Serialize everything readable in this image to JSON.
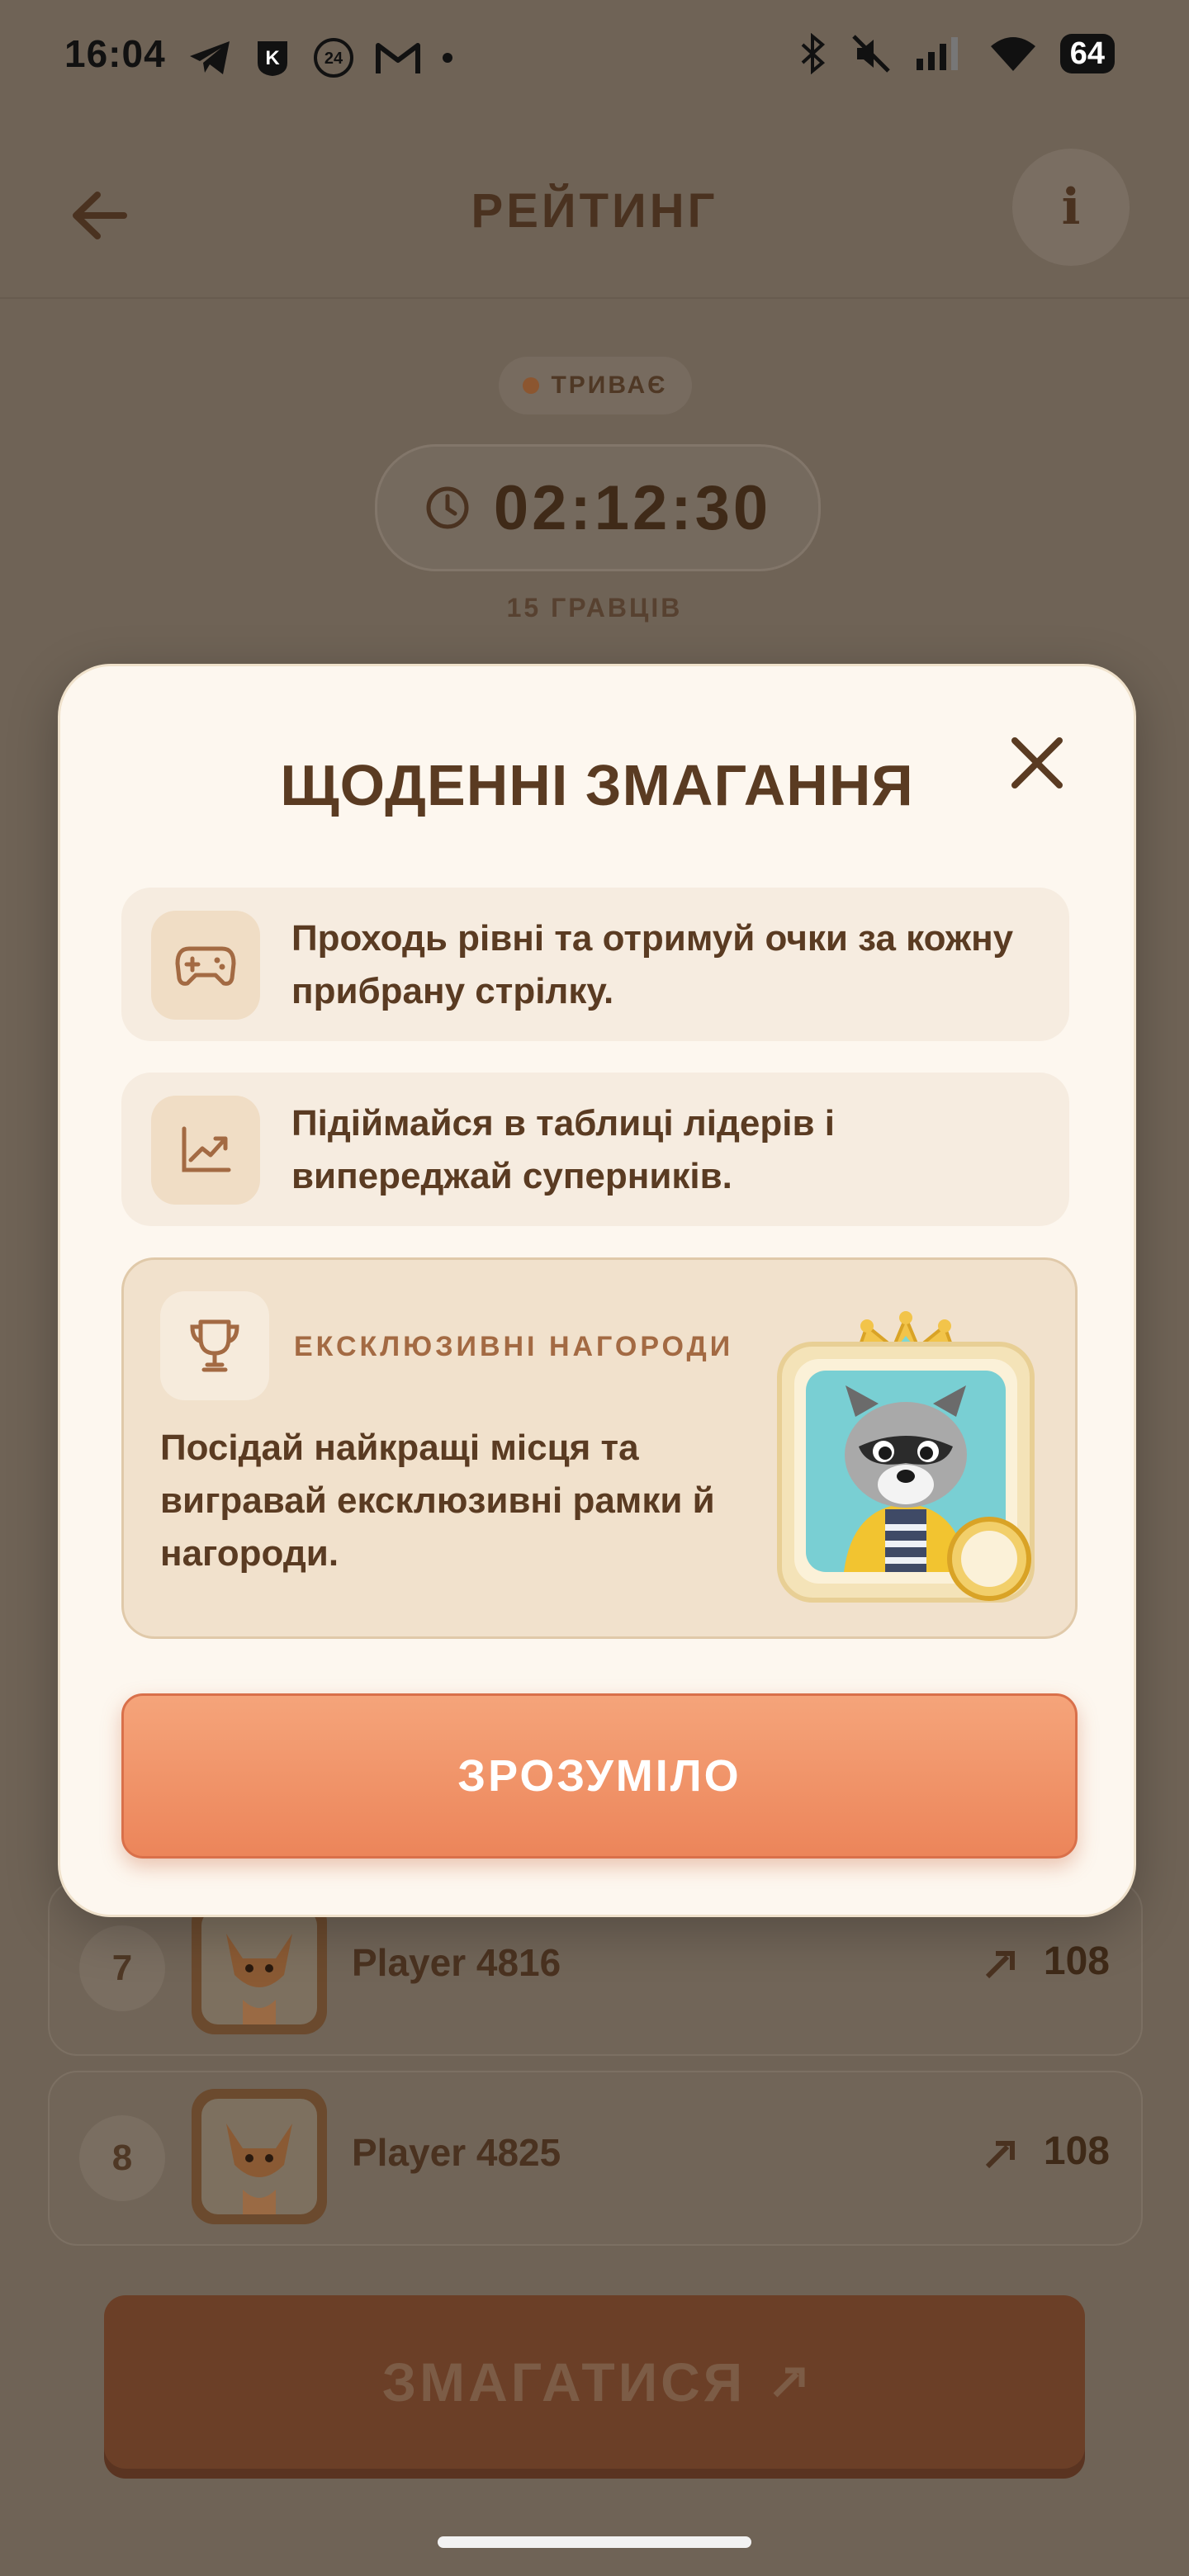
{
  "status_bar": {
    "time": "16:04",
    "left_icons": [
      "telegram-icon",
      "kyivstar-icon",
      "24-badge-icon",
      "gmail-icon",
      "dot-icon"
    ],
    "right_icons": [
      "bluetooth-icon",
      "mute-icon",
      "signal-icon",
      "wifi-icon"
    ],
    "battery": "64"
  },
  "header": {
    "title": "РЕЙТИНГ",
    "back_icon": "arrow-left-icon",
    "info_label": "i"
  },
  "competition": {
    "status": "ТРИВАЄ",
    "timer": "02:12:30",
    "players": "15 ГРАВЦІВ"
  },
  "leaderboard": {
    "rows": [
      {
        "rank": "7",
        "name": "Player 4816",
        "score": "108"
      },
      {
        "rank": "8",
        "name": "Player 4825",
        "score": "108"
      }
    ]
  },
  "compete_button": {
    "label": "ЗМАГАТИСЯ"
  },
  "modal": {
    "title": "ЩОДЕННІ ЗМАГАННЯ",
    "cards": [
      {
        "icon": "gamepad-icon",
        "text": "Проходь рівні та отримуй очки за кожну прибрану стрілку."
      },
      {
        "icon": "chart-up-icon",
        "text": "Підіймайся в таблиці лідерів і випереджай суперників."
      }
    ],
    "reward": {
      "icon": "trophy-icon",
      "label": "ЕКСКЛЮЗИВНІ НАГОРОДИ",
      "text": "Посідай найкращі місця та вигравай ексклюзивні рамки й нагороди."
    },
    "button": "ЗРОЗУМІЛО"
  },
  "colors": {
    "accent": "#ec855a",
    "modal_bg": "#fdf7ef",
    "text_brown": "#5a3b22"
  }
}
